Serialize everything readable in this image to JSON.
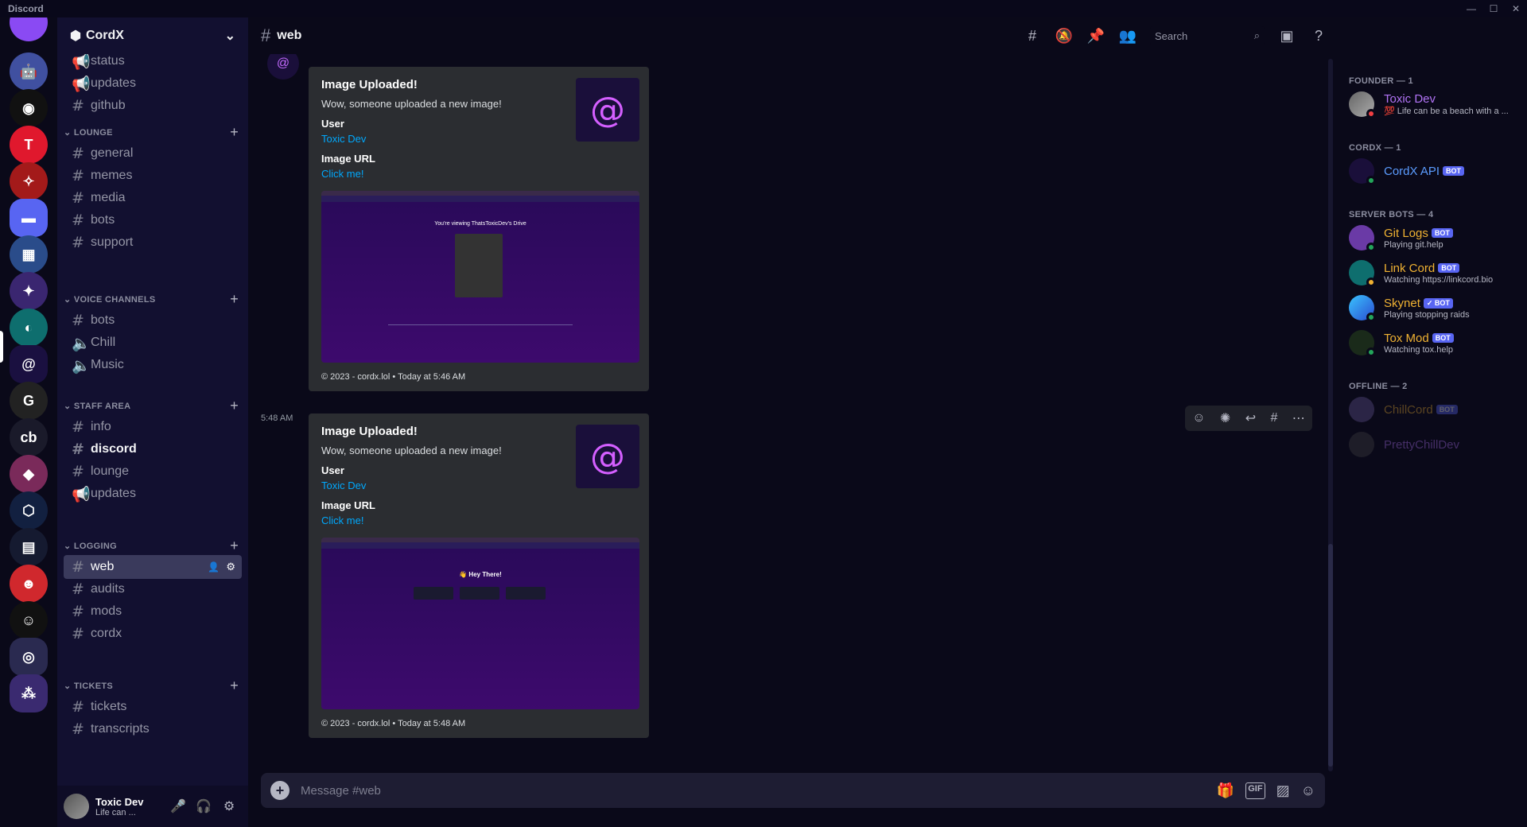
{
  "app": {
    "name": "Discord"
  },
  "server": {
    "name": "CordX"
  },
  "channels": {
    "top": [
      {
        "name": "status",
        "icon": "announce"
      },
      {
        "name": "updates",
        "icon": "announce"
      },
      {
        "name": "github",
        "icon": "hash"
      }
    ],
    "categories": [
      {
        "name": "LOUNGE",
        "items": [
          {
            "name": "general",
            "icon": "hash"
          },
          {
            "name": "memes",
            "icon": "hash"
          },
          {
            "name": "media",
            "icon": "hash"
          },
          {
            "name": "bots",
            "icon": "hash"
          },
          {
            "name": "support",
            "icon": "hash"
          }
        ]
      },
      {
        "name": "VOICE CHANNELS",
        "items": [
          {
            "name": "bots",
            "icon": "hash"
          },
          {
            "name": "Chill",
            "icon": "speaker"
          },
          {
            "name": "Music",
            "icon": "speaker"
          }
        ]
      },
      {
        "name": "STAFF AREA",
        "items": [
          {
            "name": "info",
            "icon": "hash"
          },
          {
            "name": "discord",
            "icon": "hash"
          },
          {
            "name": "lounge",
            "icon": "hash"
          },
          {
            "name": "updates",
            "icon": "announce"
          }
        ]
      },
      {
        "name": "LOGGING",
        "items": [
          {
            "name": "web",
            "icon": "hash"
          },
          {
            "name": "audits",
            "icon": "hash"
          },
          {
            "name": "mods",
            "icon": "hash"
          },
          {
            "name": "cordx",
            "icon": "hash"
          }
        ]
      },
      {
        "name": "TICKETS",
        "items": [
          {
            "name": "tickets",
            "icon": "hash"
          },
          {
            "name": "transcripts",
            "icon": "hash"
          }
        ]
      }
    ]
  },
  "user": {
    "name": "Toxic Dev",
    "status": "Life can ..."
  },
  "header": {
    "channel": "web",
    "search_placeholder": "Search"
  },
  "messages": [
    {
      "title": "Image Uploaded!",
      "desc": "Wow, someone uploaded a new image!",
      "field1_name": "User",
      "field1_value": "Toxic Dev",
      "field2_name": "Image URL",
      "field2_value": "Click me!",
      "footer": "© 2023 - cordx.lol • Today at 5:46 AM",
      "shot_text": "You're viewing ThatsToxicDev's Drive"
    },
    {
      "time": "5:48 AM",
      "title": "Image Uploaded!",
      "desc": "Wow, someone uploaded a new image!",
      "field1_name": "User",
      "field1_value": "Toxic Dev",
      "field2_name": "Image URL",
      "field2_value": "Click me!",
      "footer": "© 2023 - cordx.lol • Today at 5:48 AM",
      "shot_text": "👋 Hey There!"
    }
  ],
  "composer": {
    "placeholder": "Message #web"
  },
  "members": {
    "groups": [
      {
        "name": "FOUNDER — 1"
      },
      {
        "name": "CORDX — 1"
      },
      {
        "name": "SERVER BOTS — 4"
      },
      {
        "name": "OFFLINE — 2"
      }
    ],
    "list": [
      {
        "name": "Toxic Dev",
        "activity": "💯 Life can be a beach with a ...",
        "color": "#b173f5",
        "status": "#f23f43",
        "bot": false
      },
      {
        "name": "CordX API",
        "activity": "",
        "color": "#5b9cff",
        "status": "#23a55a",
        "bot": true,
        "bot_label": "BOT"
      },
      {
        "name": "Git Logs",
        "activity": "Playing git.help",
        "color": "#f0b232",
        "status": "#23a55a",
        "bot": true,
        "bot_label": "BOT"
      },
      {
        "name": "Link Cord",
        "activity": "Watching https://linkcord.bio",
        "color": "#f0b232",
        "status": "#f0b232",
        "bot": true,
        "bot_label": "BOT"
      },
      {
        "name": "Skynet",
        "activity": "Playing stopping raids",
        "color": "#f0b232",
        "status": "#23a55a",
        "bot": true,
        "bot_label": "✓ BOT"
      },
      {
        "name": "Tox Mod",
        "activity": "Watching tox.help",
        "color": "#f0b232",
        "status": "#23a55a",
        "bot": true,
        "bot_label": "BOT"
      },
      {
        "name": "ChillCord",
        "activity": "",
        "color": "#f0b232",
        "status": "",
        "bot": true,
        "bot_label": "BOT"
      },
      {
        "name": "PrettyChillDev",
        "activity": "",
        "color": "#b173f5",
        "status": "",
        "bot": false
      }
    ]
  }
}
